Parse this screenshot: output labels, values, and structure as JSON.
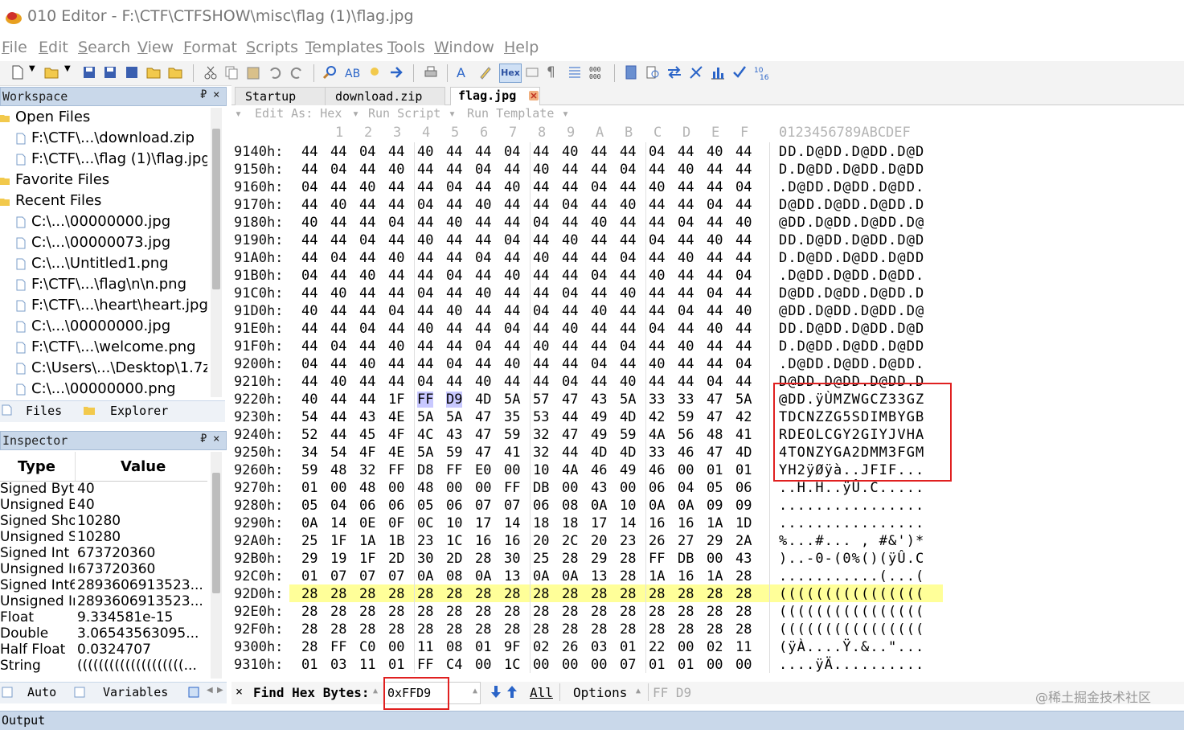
{
  "window": {
    "title": "010 Editor - F:\\CTF\\CTFSHOW\\misc\\flag (1)\\flag.jpg"
  },
  "menu": [
    "File",
    "Edit",
    "Search",
    "View",
    "Format",
    "Scripts",
    "Templates",
    "Tools",
    "Window",
    "Help"
  ],
  "toolbar": {
    "hex_label": "Hex"
  },
  "workspace": {
    "title": "Workspace",
    "pin": "₽",
    "close": "×",
    "sections": [
      {
        "label": "Open Files",
        "items": [
          "F:\\CTF\\...\\download.zip",
          "F:\\CTF\\...\\flag (1)\\flag.jpg"
        ]
      },
      {
        "label": "Favorite Files",
        "items": []
      },
      {
        "label": "Recent Files",
        "items": [
          "C:\\...\\00000000.jpg",
          "C:\\...\\00000073.jpg",
          "C:\\...\\Untitled1.png",
          "F:\\CTF\\...\\flag\\n\\n.png",
          "F:\\CTF\\...\\heart\\heart.jpg",
          "C:\\...\\00000000.jpg",
          "F:\\CTF\\...\\welcome.png",
          "C:\\Users\\...\\Desktop\\1.7z",
          "C:\\...\\00000000.png"
        ]
      }
    ],
    "tabs": [
      "Files",
      "Explorer"
    ]
  },
  "inspector": {
    "title": "Inspector",
    "pin": "₽",
    "close": "×",
    "col_type": "Type",
    "col_value": "Value",
    "rows": [
      {
        "type": "Signed Byte",
        "value": "40"
      },
      {
        "type": "Unsigned Byte",
        "value": "40"
      },
      {
        "type": "Signed Short",
        "value": "10280"
      },
      {
        "type": "Unsigned Short",
        "value": "10280"
      },
      {
        "type": "Signed Int",
        "value": "673720360"
      },
      {
        "type": "Unsigned Int",
        "value": "673720360"
      },
      {
        "type": "Signed Int64",
        "value": "2893606913523..."
      },
      {
        "type": "Unsigned Int64",
        "value": "2893606913523..."
      },
      {
        "type": "Float",
        "value": "9.334581e-15"
      },
      {
        "type": "Double",
        "value": "3.06543563095..."
      },
      {
        "type": "Half Float",
        "value": "0.0324707"
      },
      {
        "type": "String",
        "value": "((((((((((((((((((((..."
      }
    ],
    "tabs": [
      "Auto",
      "Variables"
    ]
  },
  "editor": {
    "tabs": [
      "Startup",
      "download.zip",
      "flag.jpg"
    ],
    "active_tab": "flag.jpg",
    "subbar": {
      "edit_as": "Edit As: Hex",
      "run_script": "Run Script",
      "run_template": "Run Template"
    },
    "col_headers": [
      "0",
      "1",
      "2",
      "3",
      "4",
      "5",
      "6",
      "7",
      "8",
      "9",
      "A",
      "B",
      "C",
      "D",
      "E",
      "F"
    ],
    "ascii_header": "0123456789ABCDEF",
    "rows": [
      {
        "addr": "9140h:",
        "bytes": [
          "44",
          "44",
          "04",
          "44",
          "40",
          "44",
          "44",
          "04",
          "44",
          "40",
          "44",
          "44",
          "04",
          "44",
          "40",
          "44"
        ],
        "ascii": "DD.D@DD.D@DD.D@D"
      },
      {
        "addr": "9150h:",
        "bytes": [
          "44",
          "04",
          "44",
          "40",
          "44",
          "44",
          "04",
          "44",
          "40",
          "44",
          "44",
          "04",
          "44",
          "40",
          "44",
          "44"
        ],
        "ascii": "D.D@DD.D@DD.D@DD"
      },
      {
        "addr": "9160h:",
        "bytes": [
          "04",
          "44",
          "40",
          "44",
          "44",
          "04",
          "44",
          "40",
          "44",
          "44",
          "04",
          "44",
          "40",
          "44",
          "44",
          "04"
        ],
        "ascii": ".D@DD.D@DD.D@DD."
      },
      {
        "addr": "9170h:",
        "bytes": [
          "44",
          "40",
          "44",
          "44",
          "04",
          "44",
          "40",
          "44",
          "44",
          "04",
          "44",
          "40",
          "44",
          "44",
          "04",
          "44"
        ],
        "ascii": "D@DD.D@DD.D@DD.D"
      },
      {
        "addr": "9180h:",
        "bytes": [
          "40",
          "44",
          "44",
          "04",
          "44",
          "40",
          "44",
          "44",
          "04",
          "44",
          "40",
          "44",
          "44",
          "04",
          "44",
          "40"
        ],
        "ascii": "@DD.D@DD.D@DD.D@"
      },
      {
        "addr": "9190h:",
        "bytes": [
          "44",
          "44",
          "04",
          "44",
          "40",
          "44",
          "44",
          "04",
          "44",
          "40",
          "44",
          "44",
          "04",
          "44",
          "40",
          "44"
        ],
        "ascii": "DD.D@DD.D@DD.D@D"
      },
      {
        "addr": "91A0h:",
        "bytes": [
          "44",
          "04",
          "44",
          "40",
          "44",
          "44",
          "04",
          "44",
          "40",
          "44",
          "44",
          "04",
          "44",
          "40",
          "44",
          "44"
        ],
        "ascii": "D.D@DD.D@DD.D@DD"
      },
      {
        "addr": "91B0h:",
        "bytes": [
          "04",
          "44",
          "40",
          "44",
          "44",
          "04",
          "44",
          "40",
          "44",
          "44",
          "04",
          "44",
          "40",
          "44",
          "44",
          "04"
        ],
        "ascii": ".D@DD.D@DD.D@DD."
      },
      {
        "addr": "91C0h:",
        "bytes": [
          "44",
          "40",
          "44",
          "44",
          "04",
          "44",
          "40",
          "44",
          "44",
          "04",
          "44",
          "40",
          "44",
          "44",
          "04",
          "44"
        ],
        "ascii": "D@DD.D@DD.D@DD.D"
      },
      {
        "addr": "91D0h:",
        "bytes": [
          "40",
          "44",
          "44",
          "04",
          "44",
          "40",
          "44",
          "44",
          "04",
          "44",
          "40",
          "44",
          "44",
          "04",
          "44",
          "40"
        ],
        "ascii": "@DD.D@DD.D@DD.D@"
      },
      {
        "addr": "91E0h:",
        "bytes": [
          "44",
          "44",
          "04",
          "44",
          "40",
          "44",
          "44",
          "04",
          "44",
          "40",
          "44",
          "44",
          "04",
          "44",
          "40",
          "44"
        ],
        "ascii": "DD.D@DD.D@DD.D@D"
      },
      {
        "addr": "91F0h:",
        "bytes": [
          "44",
          "04",
          "44",
          "40",
          "44",
          "44",
          "04",
          "44",
          "40",
          "44",
          "44",
          "04",
          "44",
          "40",
          "44",
          "44"
        ],
        "ascii": "D.D@DD.D@DD.D@DD"
      },
      {
        "addr": "9200h:",
        "bytes": [
          "04",
          "44",
          "40",
          "44",
          "44",
          "04",
          "44",
          "40",
          "44",
          "44",
          "04",
          "44",
          "40",
          "44",
          "44",
          "04"
        ],
        "ascii": ".D@DD.D@DD.D@DD."
      },
      {
        "addr": "9210h:",
        "bytes": [
          "44",
          "40",
          "44",
          "44",
          "04",
          "44",
          "40",
          "44",
          "44",
          "04",
          "44",
          "40",
          "44",
          "44",
          "04",
          "44"
        ],
        "ascii": "D@DD.D@DD.D@DD.D"
      },
      {
        "addr": "9220h:",
        "bytes": [
          "40",
          "44",
          "44",
          "1F",
          "FF",
          "D9",
          "4D",
          "5A",
          "57",
          "47",
          "43",
          "5A",
          "33",
          "33",
          "47",
          "5A"
        ],
        "ascii": "@DD.ÿÙMZWGCZ33GZ"
      },
      {
        "addr": "9230h:",
        "bytes": [
          "54",
          "44",
          "43",
          "4E",
          "5A",
          "5A",
          "47",
          "35",
          "53",
          "44",
          "49",
          "4D",
          "42",
          "59",
          "47",
          "42"
        ],
        "ascii": "TDCNZZG5SDIMBYGB"
      },
      {
        "addr": "9240h:",
        "bytes": [
          "52",
          "44",
          "45",
          "4F",
          "4C",
          "43",
          "47",
          "59",
          "32",
          "47",
          "49",
          "59",
          "4A",
          "56",
          "48",
          "41"
        ],
        "ascii": "RDEOLCGY2GIYJVHA"
      },
      {
        "addr": "9250h:",
        "bytes": [
          "34",
          "54",
          "4F",
          "4E",
          "5A",
          "59",
          "47",
          "41",
          "32",
          "44",
          "4D",
          "4D",
          "33",
          "46",
          "47",
          "4D"
        ],
        "ascii": "4TONZYGA2DMM3FGM"
      },
      {
        "addr": "9260h:",
        "bytes": [
          "59",
          "48",
          "32",
          "FF",
          "D8",
          "FF",
          "E0",
          "00",
          "10",
          "4A",
          "46",
          "49",
          "46",
          "00",
          "01",
          "01"
        ],
        "ascii": "YH2ÿØÿà..JFIF..."
      },
      {
        "addr": "9270h:",
        "bytes": [
          "01",
          "00",
          "48",
          "00",
          "48",
          "00",
          "00",
          "FF",
          "DB",
          "00",
          "43",
          "00",
          "06",
          "04",
          "05",
          "06"
        ],
        "ascii": "..H.H..ÿÛ.C....."
      },
      {
        "addr": "9280h:",
        "bytes": [
          "05",
          "04",
          "06",
          "06",
          "05",
          "06",
          "07",
          "07",
          "06",
          "08",
          "0A",
          "10",
          "0A",
          "0A",
          "09",
          "09"
        ],
        "ascii": "................"
      },
      {
        "addr": "9290h:",
        "bytes": [
          "0A",
          "14",
          "0E",
          "0F",
          "0C",
          "10",
          "17",
          "14",
          "18",
          "18",
          "17",
          "14",
          "16",
          "16",
          "1A",
          "1D"
        ],
        "ascii": "................"
      },
      {
        "addr": "92A0h:",
        "bytes": [
          "25",
          "1F",
          "1A",
          "1B",
          "23",
          "1C",
          "16",
          "16",
          "20",
          "2C",
          "20",
          "23",
          "26",
          "27",
          "29",
          "2A"
        ],
        "ascii": "%...#... , #&')*"
      },
      {
        "addr": "92B0h:",
        "bytes": [
          "29",
          "19",
          "1F",
          "2D",
          "30",
          "2D",
          "28",
          "30",
          "25",
          "28",
          "29",
          "28",
          "FF",
          "DB",
          "00",
          "43"
        ],
        "ascii": ")..-0-(0%()(ÿÛ.C"
      },
      {
        "addr": "92C0h:",
        "bytes": [
          "01",
          "07",
          "07",
          "07",
          "0A",
          "08",
          "0A",
          "13",
          "0A",
          "0A",
          "13",
          "28",
          "1A",
          "16",
          "1A",
          "28"
        ],
        "ascii": "...........(...("
      },
      {
        "addr": "92D0h:",
        "bytes": [
          "28",
          "28",
          "28",
          "28",
          "28",
          "28",
          "28",
          "28",
          "28",
          "28",
          "28",
          "28",
          "28",
          "28",
          "28",
          "28"
        ],
        "ascii": "(((((((((((((((("
      },
      {
        "addr": "92E0h:",
        "bytes": [
          "28",
          "28",
          "28",
          "28",
          "28",
          "28",
          "28",
          "28",
          "28",
          "28",
          "28",
          "28",
          "28",
          "28",
          "28",
          "28"
        ],
        "ascii": "(((((((((((((((("
      },
      {
        "addr": "92F0h:",
        "bytes": [
          "28",
          "28",
          "28",
          "28",
          "28",
          "28",
          "28",
          "28",
          "28",
          "28",
          "28",
          "28",
          "28",
          "28",
          "28",
          "28"
        ],
        "ascii": "(((((((((((((((("
      },
      {
        "addr": "9300h:",
        "bytes": [
          "28",
          "FF",
          "C0",
          "00",
          "11",
          "08",
          "01",
          "9F",
          "02",
          "26",
          "03",
          "01",
          "22",
          "00",
          "02",
          "11"
        ],
        "ascii": "(ÿÀ....Ÿ.&..\"..."
      },
      {
        "addr": "9310h:",
        "bytes": [
          "01",
          "03",
          "11",
          "01",
          "FF",
          "C4",
          "00",
          "1C",
          "00",
          "00",
          "00",
          "07",
          "01",
          "01",
          "00",
          "00"
        ],
        "ascii": "....ÿÄ.........."
      }
    ]
  },
  "findbar": {
    "close": "×",
    "label": "Find Hex Bytes:",
    "value": "0xFFD9",
    "all_label": "All",
    "options_label": "Options",
    "hex_readout": "FF D9"
  },
  "watermark": "@稀土掘金技术社区",
  "output": {
    "title": "Output"
  },
  "colors": {
    "panel_header": "#c9d8ea",
    "row_highlight": "#ffff99",
    "selection": "#c8c8ff",
    "annotation_red": "#e02020"
  }
}
